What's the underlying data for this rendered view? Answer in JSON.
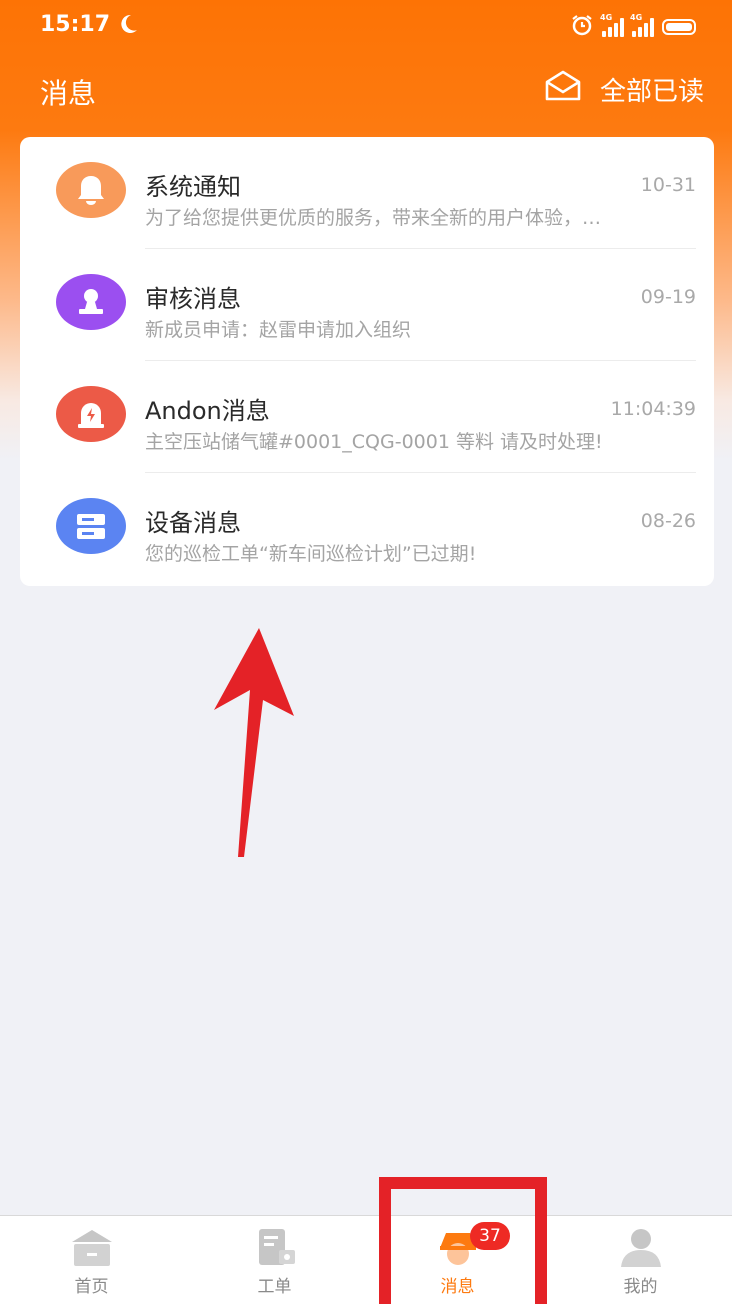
{
  "status_bar": {
    "time": "15:17",
    "network_1": "4G",
    "network_2": "4G"
  },
  "header": {
    "title": "消息",
    "mark_all_read": "全部已读"
  },
  "messages": [
    {
      "title": "系统通知",
      "time": "10-31",
      "preview": "为了给您提供更优质的服务，带来全新的用户体验，…",
      "icon": "bell-icon",
      "color": "#f89a5a"
    },
    {
      "title": "审核消息",
      "time": "09-19",
      "preview": "新成员申请：赵雷申请加入组织",
      "icon": "stamp-icon",
      "color": "#9b4ff0"
    },
    {
      "title": "Andon消息",
      "time": "11:04:39",
      "preview": "主空压站储气罐#0001_CQG-0001 等料 请及时处理!",
      "icon": "alarm-icon",
      "color": "#ec5a47"
    },
    {
      "title": "设备消息",
      "time": "08-26",
      "preview": "您的巡检工单“新车间巡检计划”已过期!",
      "icon": "server-icon",
      "color": "#5b84f2"
    }
  ],
  "tabbar": {
    "tabs": [
      {
        "label": "首页",
        "icon": "home-icon"
      },
      {
        "label": "工单",
        "icon": "work-order-icon"
      },
      {
        "label": "消息",
        "icon": "message-icon",
        "badge": "37",
        "active": true
      },
      {
        "label": "我的",
        "icon": "profile-icon"
      }
    ]
  },
  "colors": {
    "accent": "#fd7a10",
    "badge": "#ee2a24",
    "annotation": "#e42227"
  }
}
